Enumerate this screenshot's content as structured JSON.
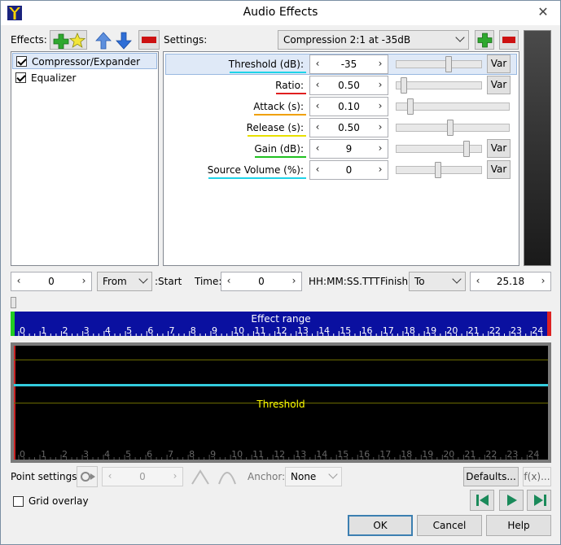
{
  "window": {
    "title": "Audio Effects",
    "close_glyph": "✕"
  },
  "effects": {
    "label": "Effects:",
    "items": [
      {
        "label": "Compressor/Expander",
        "checked": true
      },
      {
        "label": "Equalizer",
        "checked": true
      }
    ]
  },
  "settings": {
    "label": "Settings:",
    "preset": "Compression 2:1 at -35dB",
    "params": [
      {
        "label": "Threshold (dB):",
        "value": "-35",
        "underline_color": "#1fd3e8",
        "slider": 0.62,
        "var": "Var",
        "has_var": true
      },
      {
        "label": "Ratio:",
        "value": "0.50",
        "underline_color": "#e02020",
        "slider": 0.05,
        "var": "Var",
        "has_var": true
      },
      {
        "label": "Attack (s):",
        "value": "0.10",
        "underline_color": "#f0a000",
        "slider": 0.1,
        "var": "",
        "has_var": false
      },
      {
        "label": "Release (s):",
        "value": "0.50",
        "underline_color": "#e8e000",
        "slider": 0.48,
        "var": "",
        "has_var": false
      },
      {
        "label": "Gain (dB):",
        "value": "9",
        "underline_color": "#20c020",
        "slider": 0.85,
        "var": "Var",
        "has_var": true
      },
      {
        "label": "Source Volume (%):",
        "value": "0",
        "underline_color": "#1fd3e8",
        "slider": 0.49,
        "var": "Var",
        "has_var": true
      }
    ]
  },
  "range": {
    "start_value": "0",
    "from_option": "From",
    "start_label": ":Start",
    "time_label": "Time:",
    "time_value": "0",
    "time_format": "HH:MM:SS.TTT",
    "finish_label": "Finish:",
    "to_option": "To",
    "finish_value": "25.18"
  },
  "ruler": {
    "title": "Effect range",
    "ticks": [
      "0",
      "1",
      "2",
      "3",
      "4",
      "5",
      "6",
      "7",
      "8",
      "9",
      "10",
      "11",
      "12",
      "13",
      "14",
      "15",
      "16",
      "17",
      "18",
      "19",
      "20",
      "21",
      "22",
      "23",
      "24",
      "2"
    ]
  },
  "graph": {
    "threshold_label": "Threshold",
    "threshold_color": "#ffff00",
    "line_color": "#33ccdd"
  },
  "point": {
    "label": "Point settings:",
    "value": "0",
    "anchor_label": "Anchor:",
    "anchor_value": "None",
    "defaults": "Defaults...",
    "fx": "f(x)..."
  },
  "grid_overlay": {
    "label": "Grid overlay",
    "checked": false
  },
  "buttons": {
    "ok": "OK",
    "cancel": "Cancel",
    "help": "Help"
  }
}
